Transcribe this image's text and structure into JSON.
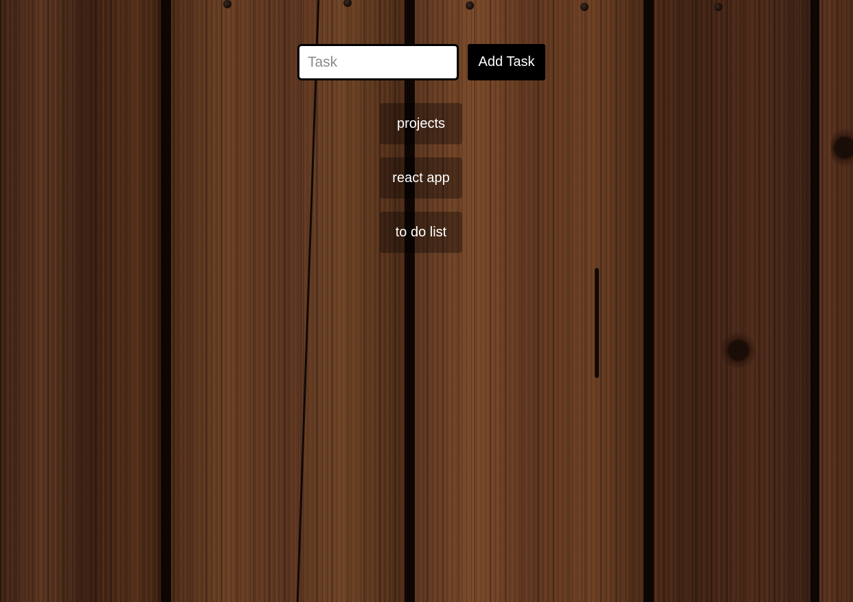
{
  "form": {
    "task_placeholder": "Task",
    "task_value": "",
    "add_label": "Add Task"
  },
  "tasks": [
    {
      "label": "projects"
    },
    {
      "label": "react app"
    },
    {
      "label": "to do list"
    }
  ],
  "colors": {
    "button_bg": "#000000",
    "item_bg": "rgba(0,0,0,0.32)",
    "text": "#ffffff"
  }
}
